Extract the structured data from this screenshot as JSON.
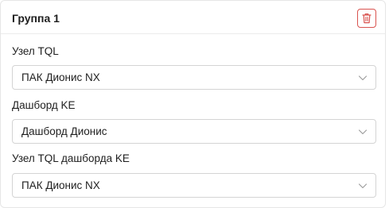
{
  "group": {
    "title": "Группа 1",
    "delete_icon": "trash-icon",
    "accent_color": "#d9534f"
  },
  "fields": [
    {
      "label": "Узел TQL",
      "value": "ПАК Дионис NX"
    },
    {
      "label": "Дашборд KE",
      "value": "Дашборд Дионис"
    },
    {
      "label": "Узел TQL дашборда KE",
      "value": "ПАК Дионис NX"
    }
  ]
}
